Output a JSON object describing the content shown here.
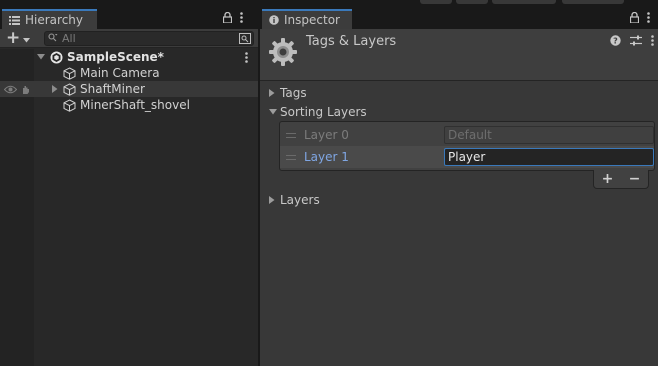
{
  "hierarchy": {
    "tab_label": "Hierarchy",
    "create_label": "+",
    "search_placeholder": "All",
    "scene": {
      "label": "SampleScene*",
      "expanded": true
    },
    "items": [
      {
        "label": "Main Camera",
        "has_children": false
      },
      {
        "label": "ShaftMiner",
        "has_children": true,
        "collapsed": true
      },
      {
        "label": "MinerShaft_shovel",
        "has_children": false
      }
    ]
  },
  "inspector": {
    "tab_label": "Inspector",
    "title": "Tags & Layers",
    "sections": {
      "tags": {
        "label": "Tags",
        "expanded": false
      },
      "sorting_layers": {
        "label": "Sorting Layers",
        "expanded": true
      },
      "layers": {
        "label": "Layers",
        "expanded": false
      }
    },
    "sorting_layers": [
      {
        "name": "Layer 0",
        "value": "Default",
        "editable": false
      },
      {
        "name": "Layer 1",
        "value": "Player",
        "editable": true,
        "selected": true
      }
    ],
    "add_label": "+",
    "remove_label": "−"
  },
  "colors": {
    "accent": "#3a79bb",
    "panel_dark": "#282828",
    "panel": "#383838",
    "selected_label": "#7fa6e3"
  },
  "icons": [
    "hamburger-menu-icon",
    "lock-icon",
    "kebab-menu-icon",
    "search-icon",
    "scene-search-icon",
    "unity-scene-icon",
    "gameobject-cube-icon",
    "visibility-eye-icon",
    "pickable-hand-icon",
    "info-icon",
    "settings-gear-icon",
    "help-icon",
    "presets-icon",
    "foldout-arrow-icon"
  ]
}
